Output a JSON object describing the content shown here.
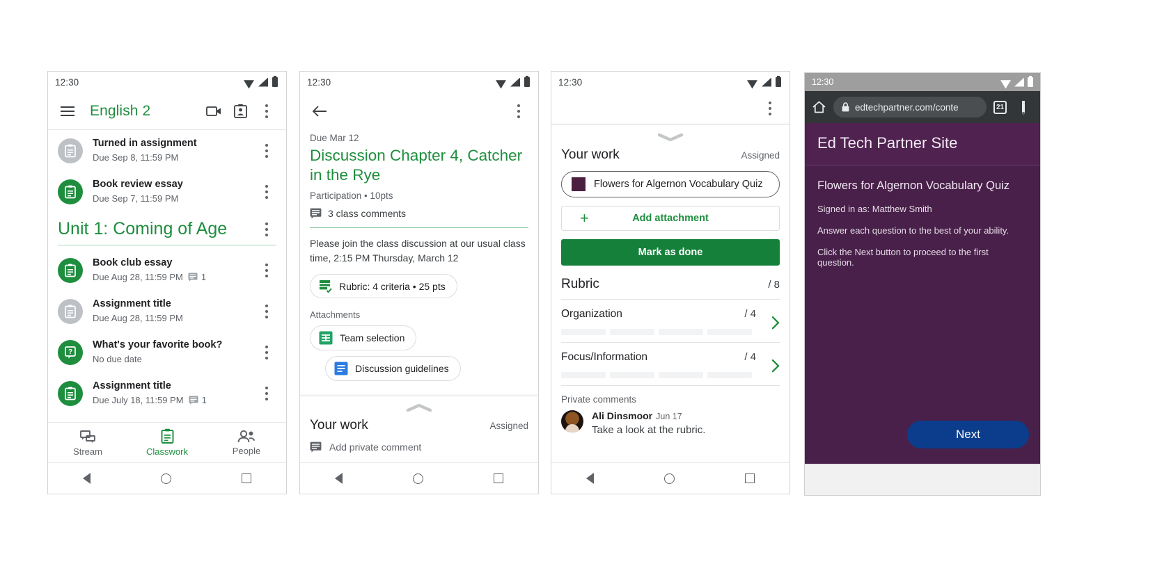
{
  "panel1": {
    "status": {
      "time": "12:30",
      "icons": [
        "wifi-icon",
        "signal-icon",
        "battery-icon"
      ]
    },
    "appbar": {
      "menu_icon": "hamburger-menu-icon",
      "title": "English 2",
      "meet_icon": "video-camera-icon",
      "folder_icon": "class-drive-folder-icon",
      "overflow_icon": "kebab-menu-icon"
    },
    "top_items": [
      {
        "title": "Turned in assignment",
        "subtitle": "Due Sep 8, 11:59 PM",
        "icon": "assignment-icon",
        "icon_color": "grey",
        "comments": ""
      },
      {
        "title": "Book review essay",
        "subtitle": "Due Sep 7, 11:59 PM",
        "icon": "assignment-icon",
        "icon_color": "green",
        "comments": ""
      }
    ],
    "section": {
      "title": "Unit 1: Coming of Age",
      "overflow_icon": "kebab-menu-icon"
    },
    "section_items": [
      {
        "title": "Book club essay",
        "subtitle": "Due Aug 28, 11:59 PM",
        "icon": "assignment-icon",
        "icon_color": "green",
        "comments": "1"
      },
      {
        "title": "Assignment title",
        "subtitle": "Due Aug 28, 11:59 PM",
        "icon": "assignment-icon",
        "icon_color": "grey",
        "comments": ""
      },
      {
        "title": "What's your favorite book?",
        "subtitle": "No due date",
        "icon": "question-icon",
        "icon_color": "green",
        "comments": ""
      },
      {
        "title": "Assignment title",
        "subtitle": "Due July 18, 11:59 PM",
        "icon": "assignment-icon",
        "icon_color": "green",
        "comments": "1"
      }
    ],
    "bottom_nav": [
      {
        "label": "Stream",
        "icon": "stream-icon",
        "active": false
      },
      {
        "label": "Classwork",
        "icon": "classwork-icon",
        "active": true
      },
      {
        "label": "People",
        "icon": "people-icon",
        "active": false
      }
    ]
  },
  "panel2": {
    "status": {
      "time": "12:30"
    },
    "appbar": {
      "back_icon": "back-arrow-icon",
      "overflow_icon": "kebab-menu-icon"
    },
    "due_label": "Due Mar 12",
    "title": "Discussion Chapter 4, Catcher in the Rye",
    "meta": "Participation • 10pts",
    "class_comments": "3 class comments",
    "body": "Please join the class discussion at our usual class time, 2:15 PM Thursday, March 12",
    "rubric_chip": "Rubric: 4 criteria • 25 pts",
    "attachments_label": "Attachments",
    "attachments": [
      {
        "name": "Team selection",
        "icon": "google-sheets-icon"
      },
      {
        "name": "Discussion guidelines",
        "icon": "google-docs-icon"
      }
    ],
    "your_work": {
      "title": "Your work",
      "status": "Assigned",
      "private_comment_placeholder": "Add private comment"
    }
  },
  "panel3": {
    "status": {
      "time": "12:30"
    },
    "appbar": {
      "overflow_icon": "kebab-menu-icon"
    },
    "your_work": {
      "title": "Your work",
      "status": "Assigned"
    },
    "attachment": {
      "name": "Flowers for Algernon Vocabulary Quiz",
      "thumb_color": "#4a1f40"
    },
    "add_attachment_label": "Add attachment",
    "mark_done_label": "Mark as done",
    "rubric": {
      "title": "Rubric",
      "total": "/ 8",
      "criteria": [
        {
          "name": "Organization",
          "score": "/ 4",
          "levels": 4,
          "chevron": "chevron-right-icon"
        },
        {
          "name": "Focus/Information",
          "score": "/ 4",
          "levels": 4,
          "chevron": "chevron-right-icon"
        }
      ]
    },
    "private_comments": {
      "heading": "Private comments",
      "items": [
        {
          "author": "Ali Dinsmoor",
          "date": "Jun 17",
          "text": "Take a look at the rubric."
        }
      ]
    }
  },
  "panel4": {
    "status": {
      "time": "12:30"
    },
    "browser": {
      "home_icon": "home-icon",
      "lock_icon": "lock-icon",
      "url": "edtechpartner.com/conte",
      "tab_count": "21",
      "overflow_icon": "kebab-menu-icon"
    },
    "page": {
      "site_title": "Ed Tech Partner Site",
      "quiz_title": "Flowers for Algernon Vocabulary Quiz",
      "signed_in": "Signed in as: Matthew Smith",
      "instruction_1": "Answer each question to the best of your ability.",
      "instruction_2": "Click the Next button to proceed to the first question.",
      "next_label": "Next"
    }
  },
  "colors": {
    "classroom_green": "#1e8e3e",
    "mark_done_green": "#15803a",
    "browser_chrome": "#323639",
    "page_purple": "#48204a",
    "next_blue": "#0b3d8c"
  }
}
